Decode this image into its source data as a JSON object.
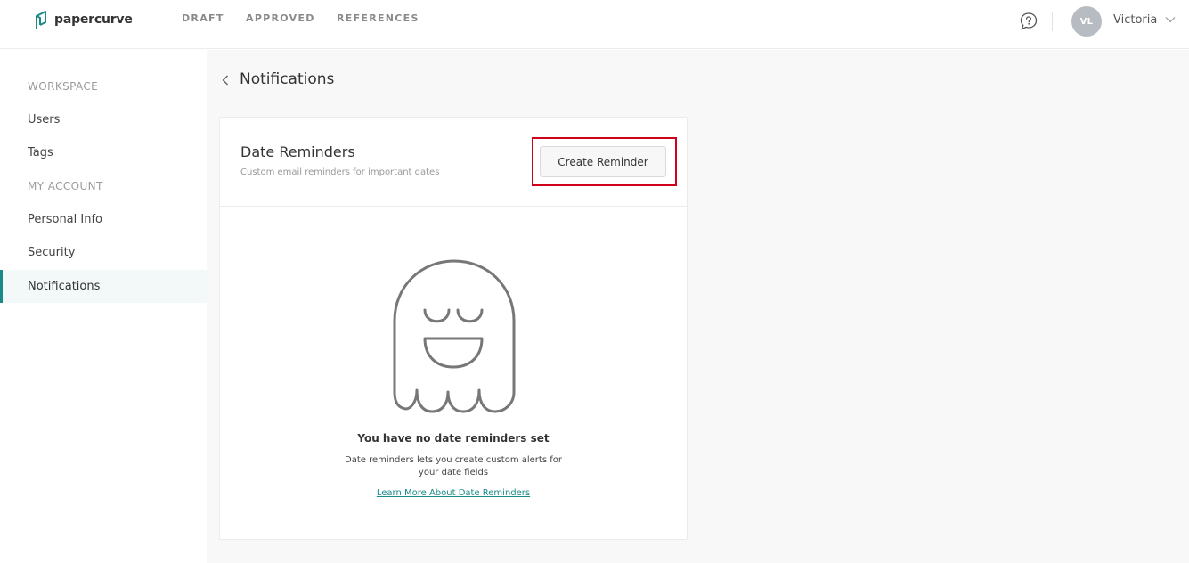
{
  "brand": {
    "name": "papercurve",
    "color": "#1a8a87"
  },
  "nav": {
    "items": [
      "DRAFT",
      "APPROVED",
      "REFERENCES"
    ]
  },
  "user": {
    "initials": "VL",
    "name": "Victoria"
  },
  "sidebar": {
    "workspace_label": "WORKSPACE",
    "account_label": "MY ACCOUNT",
    "items": [
      "Users",
      "Tags",
      "Personal Info",
      "Security",
      "Notifications"
    ],
    "active": "Notifications"
  },
  "page": {
    "title": "Notifications"
  },
  "card": {
    "title": "Date Reminders",
    "subtitle": "Custom email reminders for important dates",
    "button_label": "Create Reminder",
    "empty_title": "You have no date reminders set",
    "empty_desc_line1": "Date reminders lets you create custom alerts for",
    "empty_desc_line2": "your date fields",
    "link_label": "Learn More About Date Reminders"
  },
  "icons": [
    "papercurve-logo-icon",
    "help-chat-icon",
    "chevron-down-icon",
    "back-chevron-icon",
    "ghost-illustration-icon"
  ],
  "colors": {
    "accent": "#1a8a87",
    "highlight": "#d0021b",
    "avatar": "#b7bcc3"
  }
}
